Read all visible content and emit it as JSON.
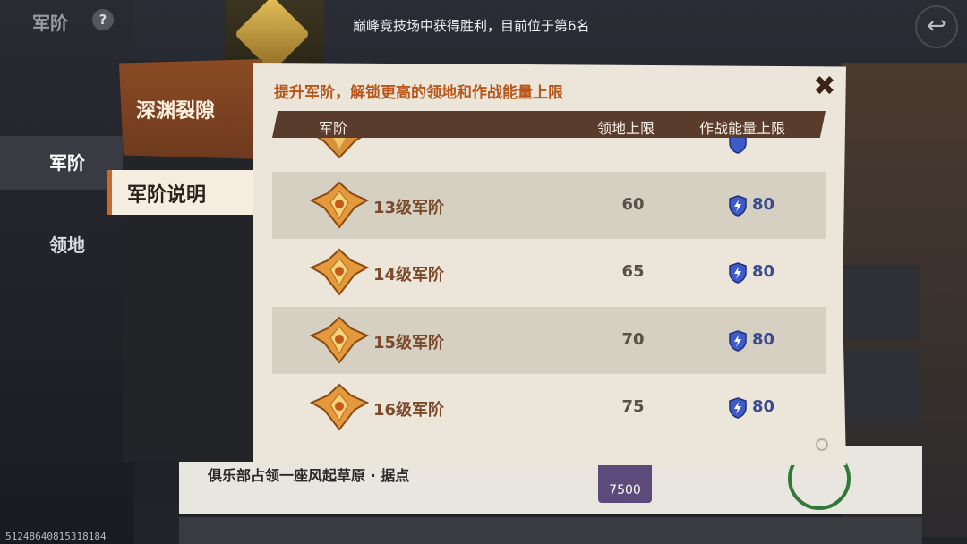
{
  "background": {
    "title": "军阶",
    "help_icon": "?",
    "notice": "巅峰竞技场中获得胜利，目前位于第6名",
    "tabs": [
      "军阶",
      "领地"
    ],
    "bottom_row_text": "俱乐部占领一座风起草原 · 据点",
    "reward_value": "7500",
    "uid": "51248640815318184"
  },
  "modal": {
    "header_title": "深渊裂隙",
    "active_tab": "军阶说明",
    "subtitle": "提升军阶，解锁更高的领地和作战能量上限",
    "close_icon": "close-icon",
    "columns": {
      "rank": "军阶",
      "land_limit": "领地上限",
      "energy_limit": "作战能量上限"
    },
    "rows": [
      {
        "rank": "13级军阶",
        "land_limit": "60",
        "energy_limit": "80"
      },
      {
        "rank": "14级军阶",
        "land_limit": "65",
        "energy_limit": "80"
      },
      {
        "rank": "15级军阶",
        "land_limit": "70",
        "energy_limit": "80"
      },
      {
        "rank": "16级军阶",
        "land_limit": "75",
        "energy_limit": "80"
      }
    ]
  },
  "colors": {
    "accent": "#b8561a",
    "header_brown": "#5a3c2c",
    "panel_cream": "#ece6da",
    "energy_blue": "#3a4a8c"
  }
}
